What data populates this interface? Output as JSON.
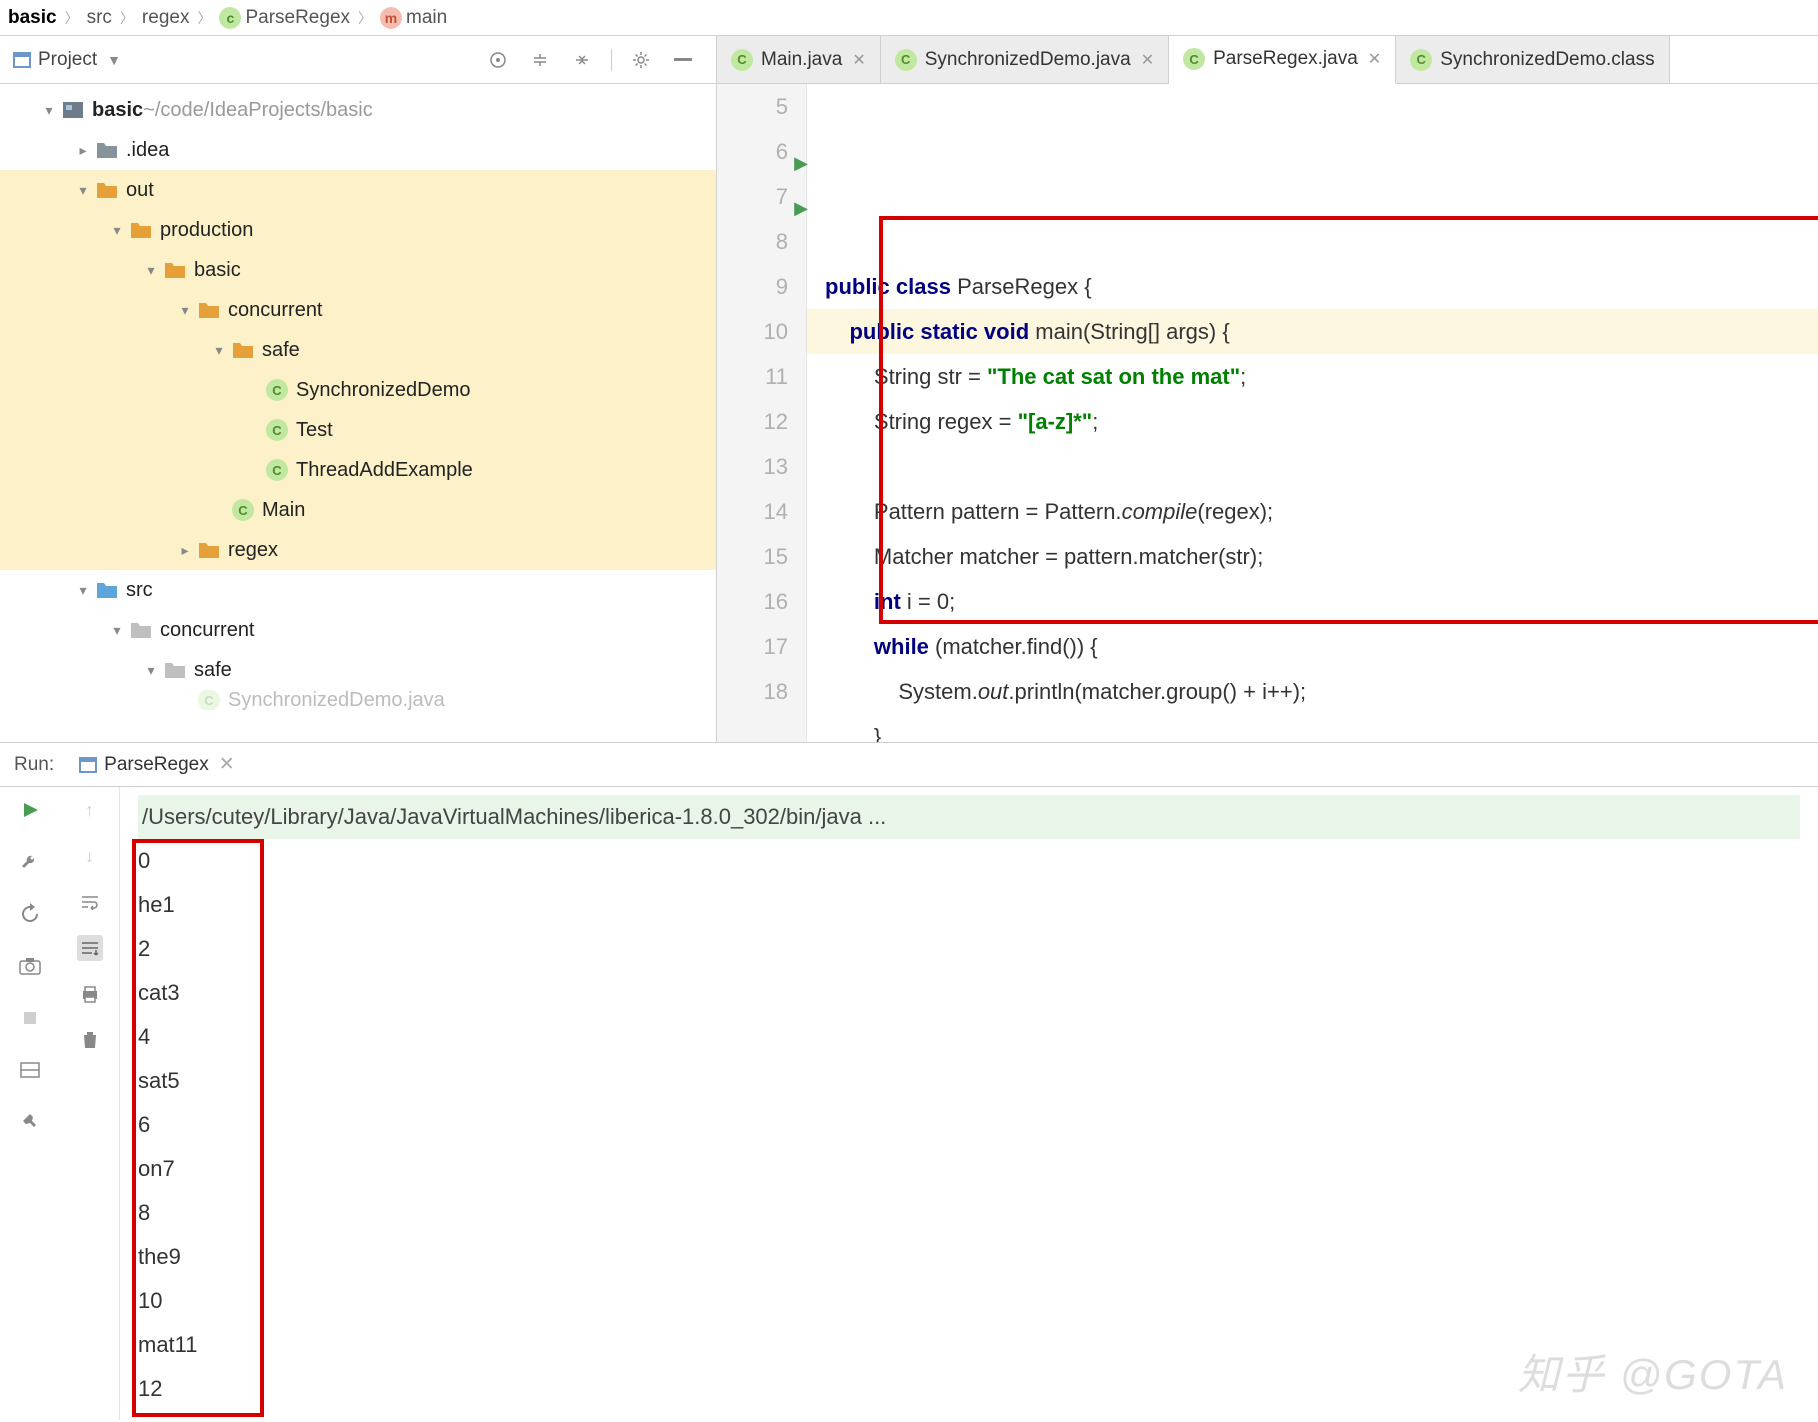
{
  "breadcrumb": [
    "basic",
    "src",
    "regex",
    "ParseRegex",
    "main"
  ],
  "breadcrumb_icons": [
    "",
    "",
    "",
    "c",
    "m"
  ],
  "sidebar": {
    "label": "Project"
  },
  "tree": [
    {
      "depth": 0,
      "arrow": "down",
      "icon": "module",
      "name": "basic",
      "bold": true,
      "path": " ~/code/IdeaProjects/basic",
      "hl": false
    },
    {
      "depth": 1,
      "arrow": "right",
      "icon": "folder-closed",
      "name": ".idea",
      "hl": false
    },
    {
      "depth": 1,
      "arrow": "down",
      "icon": "folder-open",
      "name": "out",
      "hl": true
    },
    {
      "depth": 2,
      "arrow": "down",
      "icon": "folder-open",
      "name": "production",
      "hl": true
    },
    {
      "depth": 3,
      "arrow": "down",
      "icon": "folder-open",
      "name": "basic",
      "hl": true
    },
    {
      "depth": 4,
      "arrow": "down",
      "icon": "folder-open",
      "name": "concurrent",
      "hl": true
    },
    {
      "depth": 5,
      "arrow": "down",
      "icon": "folder-open",
      "name": "safe",
      "hl": true
    },
    {
      "depth": 6,
      "arrow": "",
      "icon": "java",
      "name": "SynchronizedDemo",
      "hl": true
    },
    {
      "depth": 6,
      "arrow": "",
      "icon": "java",
      "name": "Test",
      "hl": true
    },
    {
      "depth": 6,
      "arrow": "",
      "icon": "java",
      "name": "ThreadAddExample",
      "hl": true
    },
    {
      "depth": 5,
      "arrow": "",
      "icon": "java",
      "name": "Main",
      "hl": true
    },
    {
      "depth": 4,
      "arrow": "right",
      "icon": "folder-open",
      "name": "regex",
      "hl": true
    },
    {
      "depth": 1,
      "arrow": "down",
      "icon": "src",
      "name": "src",
      "hl": false
    },
    {
      "depth": 2,
      "arrow": "down",
      "icon": "folder-light",
      "name": "concurrent",
      "hl": false
    },
    {
      "depth": 3,
      "arrow": "down",
      "icon": "folder-light",
      "name": "safe",
      "hl": false
    },
    {
      "depth": 4,
      "arrow": "",
      "icon": "java",
      "name": "SynchronizedDemo.java",
      "hl": false,
      "cut": true
    }
  ],
  "tabs": [
    {
      "label": "Main.java",
      "active": false
    },
    {
      "label": "SynchronizedDemo.java",
      "active": false
    },
    {
      "label": "ParseRegex.java",
      "active": true
    },
    {
      "label": "SynchronizedDemo.class",
      "active": false,
      "noclose": true
    }
  ],
  "code": {
    "start": 5,
    "lines": [
      {
        "n": 5,
        "html": ""
      },
      {
        "n": 6,
        "html": "<span class='kw'>public class</span> ParseRegex {",
        "run": true
      },
      {
        "n": 7,
        "html": "    <span class='kw'>public static void</span> main(String[] args) {",
        "run": true
      },
      {
        "n": 8,
        "html": "        String str = <span class='str'>\"The cat sat on the mat\"</span>;"
      },
      {
        "n": 9,
        "html": "        String regex = <span class='str'>\"[a-z]*\"</span>;"
      },
      {
        "n": 10,
        "html": "",
        "hl": true
      },
      {
        "n": 11,
        "html": "        Pattern pattern = Pattern.<span class='it'>compile</span>(regex);"
      },
      {
        "n": 12,
        "html": "        Matcher matcher = pattern.matcher(str);"
      },
      {
        "n": 13,
        "html": "        <span class='kw'>int</span> i = 0;"
      },
      {
        "n": 14,
        "html": "        <span class='kw'>while</span> (matcher.find()) {"
      },
      {
        "n": 15,
        "html": "            System.<span class='it'>out</span>.println(matcher.group() + i++);"
      },
      {
        "n": 16,
        "html": "        }"
      },
      {
        "n": 17,
        "html": "    }"
      },
      {
        "n": 18,
        "html": "}"
      }
    ]
  },
  "run": {
    "label": "Run:",
    "config": "ParseRegex",
    "cmd": "/Users/cutey/Library/Java/JavaVirtualMachines/liberica-1.8.0_302/bin/java ...",
    "output": [
      "0",
      "he1",
      "2",
      "cat3",
      "4",
      "sat5",
      "6",
      "on7",
      "8",
      "the9",
      "10",
      "mat11",
      "12"
    ]
  },
  "watermark": "知乎 @GOTA"
}
